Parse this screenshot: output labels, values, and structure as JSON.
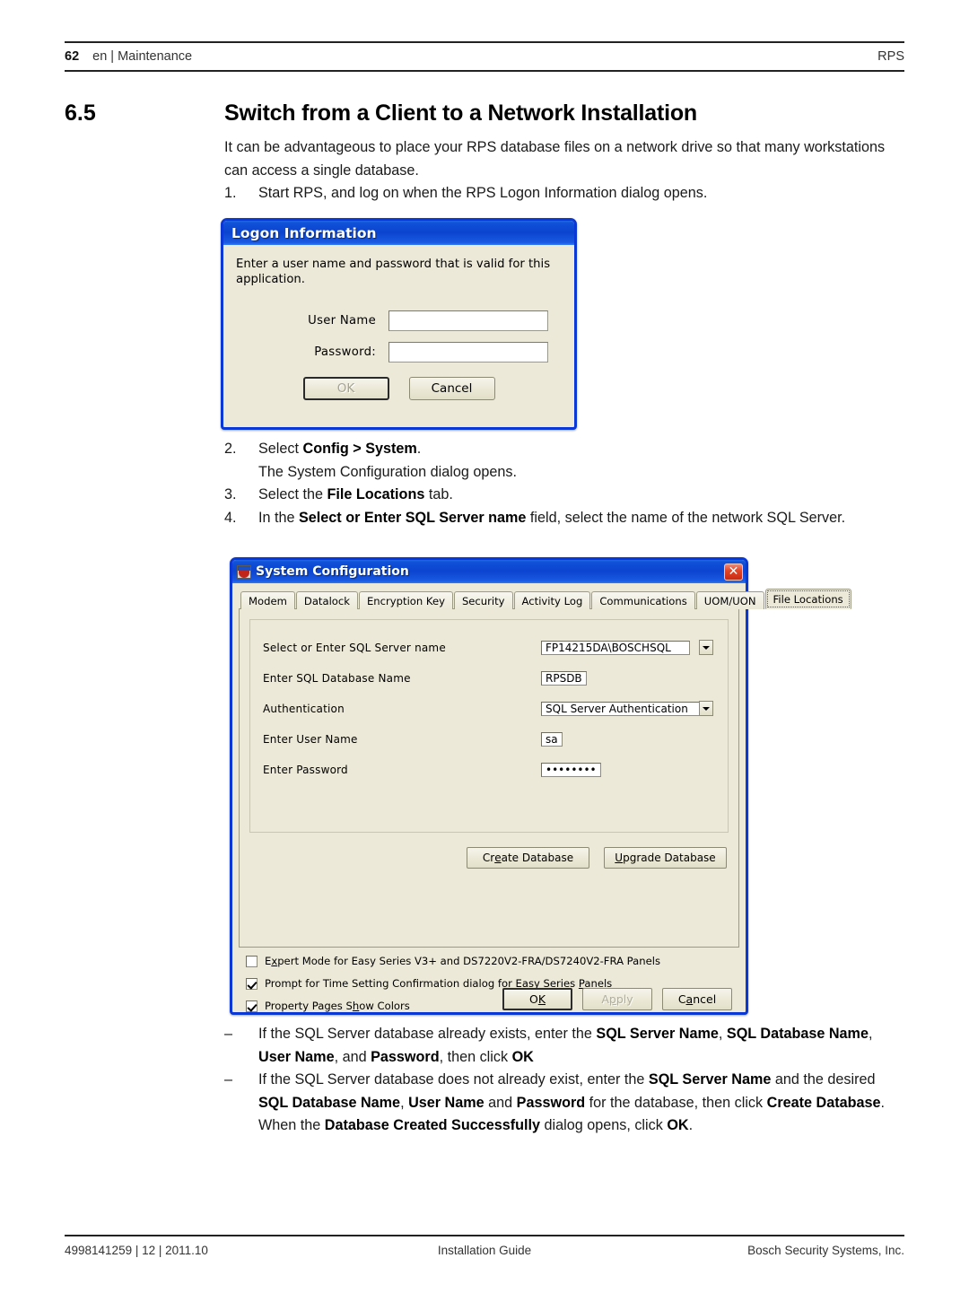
{
  "header": {
    "page_number": "62",
    "section": "en | Maintenance",
    "product": "RPS"
  },
  "heading": {
    "number": "6.5",
    "title": "Switch from a Client to a Network Installation"
  },
  "intro": {
    "paragraph": "It can be advantageous to place your RPS database files on a network drive so that many workstations can access a single database."
  },
  "steps": [
    {
      "num": "1.",
      "text": "Start RPS, and log on when the RPS Logon Information dialog opens."
    },
    {
      "num": "2.",
      "text_prefix": "Select ",
      "bold1": "Config > System",
      "text_suffix": ".",
      "sub": "The System Configuration dialog opens."
    },
    {
      "num": "3.",
      "text_prefix": "Select the ",
      "bold1": "File Locations",
      "text_suffix": " tab."
    },
    {
      "num": "4.",
      "text_prefix": "In the ",
      "bold1": "Select or Enter SQL Server name",
      "text_suffix": " field, select the name of the network SQL Server."
    }
  ],
  "logon_dialog": {
    "title": "Logon Information",
    "description": "Enter a user name and password that is valid for this application.",
    "fields": [
      {
        "label": "User Name",
        "value": ""
      },
      {
        "label": "Password:",
        "value": ""
      }
    ],
    "ok_label": "OK",
    "cancel_label": "Cancel",
    "close_glyph": "✕"
  },
  "sysconf_dialog": {
    "title": "System Configuration",
    "close_glyph": "✕",
    "tabs": [
      {
        "label": "Modem",
        "active": false
      },
      {
        "label": "Datalock",
        "active": false
      },
      {
        "label": "Encryption Key",
        "active": false
      },
      {
        "label": "Security",
        "active": false
      },
      {
        "label": "Activity Log",
        "active": false
      },
      {
        "label": "Communications",
        "active": false
      },
      {
        "label": "UOM/UON",
        "active": false
      },
      {
        "label": "File Locations",
        "active": true
      }
    ],
    "fields": [
      {
        "label": "Select or Enter SQL Server name",
        "value": "FP14215DA\\BOSCHSQL",
        "type": "combo"
      },
      {
        "label": "Enter SQL Database Name",
        "value": "RPSDB",
        "type": "text"
      },
      {
        "label": "Authentication",
        "value": "SQL Server Authentication",
        "type": "combo"
      },
      {
        "label": "Enter User Name",
        "value": "sa",
        "type": "text"
      },
      {
        "label": "Enter Password",
        "value": "••••••••",
        "type": "password"
      }
    ],
    "db_buttons": [
      {
        "label_pre": "Cr",
        "label_accel": "e",
        "label_post": "ate Database"
      },
      {
        "label_pre": "",
        "label_accel": "U",
        "label_post": "pgrade Database"
      }
    ],
    "checkboxes": [
      {
        "checked": false,
        "pre": "E",
        "accel": "x",
        "post": "pert Mode for Easy Series V3+ and DS7220V2-FRA/DS7240V2-FRA Panels"
      },
      {
        "checked": true,
        "pre": "Prompt for Time Setting Confirmation dialog for Easy Series ",
        "accel": "P",
        "post": "anels"
      },
      {
        "checked": true,
        "pre": "Property Pages S",
        "accel": "h",
        "post": "ow Colors"
      }
    ],
    "action_buttons": [
      {
        "pre": "O",
        "accel": "K",
        "post": "",
        "state": "default"
      },
      {
        "pre": "A",
        "accel": "p",
        "post": "ply",
        "state": "disabled"
      },
      {
        "pre": "C",
        "accel": "a",
        "post": "ncel",
        "state": "normal"
      }
    ]
  },
  "bullets": [
    {
      "mark": "–",
      "segments": [
        {
          "t": "If the SQL Server database already exists, enter the ",
          "b": false
        },
        {
          "t": "SQL Server Name",
          "b": true
        },
        {
          "t": ", ",
          "b": false
        },
        {
          "t": "SQL Database Name",
          "b": true
        },
        {
          "t": ", ",
          "b": false
        },
        {
          "t": "User Name",
          "b": true
        },
        {
          "t": ", and ",
          "b": false
        },
        {
          "t": "Password",
          "b": true
        },
        {
          "t": ", then click ",
          "b": false
        },
        {
          "t": "OK",
          "b": true
        }
      ]
    },
    {
      "mark": "–",
      "segments": [
        {
          "t": "If the SQL Server database does not already exist, enter the ",
          "b": false
        },
        {
          "t": "SQL Server Name",
          "b": true
        },
        {
          "t": " and the desired ",
          "b": false
        },
        {
          "t": "SQL Database Name",
          "b": true
        },
        {
          "t": ", ",
          "b": false
        },
        {
          "t": "User Name",
          "b": true
        },
        {
          "t": " and ",
          "b": false
        },
        {
          "t": "Password",
          "b": true
        },
        {
          "t": " for the database, then click ",
          "b": false
        },
        {
          "t": "Create Database",
          "b": true
        },
        {
          "t": ". When the ",
          "b": false
        },
        {
          "t": "Database Created Successfully",
          "b": true
        },
        {
          "t": " dialog opens, click ",
          "b": false
        },
        {
          "t": "OK",
          "b": true
        },
        {
          "t": ".",
          "b": false
        }
      ]
    }
  ],
  "footer": {
    "left": "4998141259 | 12 | 2011.10",
    "center": "Installation Guide",
    "right": "Bosch Security Systems, Inc."
  }
}
